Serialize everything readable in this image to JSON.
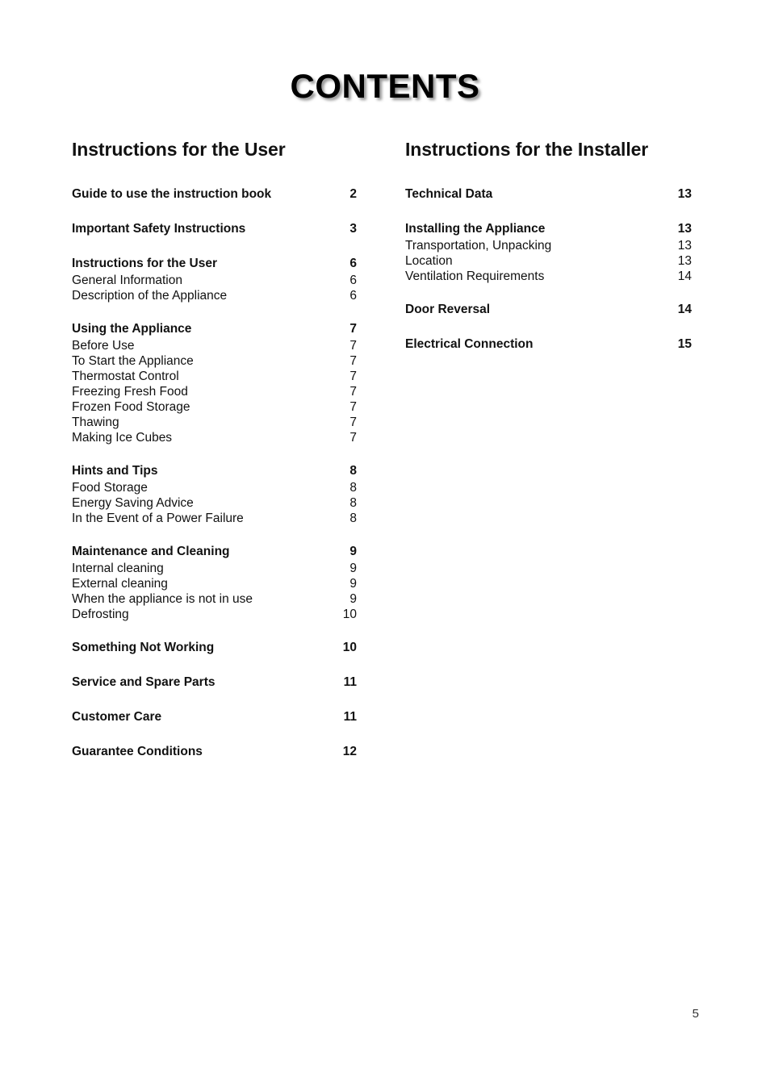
{
  "document": {
    "title": "CONTENTS",
    "folio": "5"
  },
  "columns": [
    {
      "heading": "Instructions for the User",
      "groups": [
        {
          "main": {
            "label": "Guide to use the instruction book",
            "page": "2"
          },
          "subs": []
        },
        {
          "main": {
            "label": "Important Safety Instructions",
            "page": "3"
          },
          "subs": []
        },
        {
          "main": {
            "label": "Instructions for the User",
            "page": "6"
          },
          "subs": [
            {
              "label": "General Information",
              "page": "6"
            },
            {
              "label": "Description of the Appliance",
              "page": "6"
            }
          ]
        },
        {
          "main": {
            "label": "Using the Appliance",
            "page": "7"
          },
          "subs": [
            {
              "label": "Before Use",
              "page": "7"
            },
            {
              "label": "To Start the Appliance",
              "page": "7"
            },
            {
              "label": "Thermostat Control",
              "page": "7"
            },
            {
              "label": "Freezing Fresh Food",
              "page": "7"
            },
            {
              "label": "Frozen Food Storage",
              "page": "7"
            },
            {
              "label": "Thawing",
              "page": "7"
            },
            {
              "label": "Making Ice Cubes",
              "page": "7"
            }
          ]
        },
        {
          "main": {
            "label": "Hints and Tips",
            "page": "8"
          },
          "subs": [
            {
              "label": "Food Storage",
              "page": "8"
            },
            {
              "label": "Energy Saving Advice",
              "page": "8"
            },
            {
              "label": "In the Event of a Power Failure",
              "page": "8"
            }
          ]
        },
        {
          "main": {
            "label": "Maintenance and Cleaning",
            "page": "9"
          },
          "subs": [
            {
              "label": "Internal cleaning",
              "page": "9"
            },
            {
              "label": "External cleaning",
              "page": "9"
            },
            {
              "label": "When the appliance is not in use",
              "page": "9"
            },
            {
              "label": "Defrosting",
              "page": "10"
            }
          ]
        },
        {
          "main": {
            "label": "Something Not Working",
            "page": "10"
          },
          "subs": []
        },
        {
          "main": {
            "label": "Service and Spare Parts",
            "page": "11"
          },
          "subs": []
        },
        {
          "main": {
            "label": "Customer Care",
            "page": "11"
          },
          "subs": []
        },
        {
          "main": {
            "label": "Guarantee Conditions",
            "page": "12"
          },
          "subs": []
        }
      ]
    },
    {
      "heading": "Instructions for the Installer",
      "groups": [
        {
          "main": {
            "label": "Technical Data",
            "page": "13"
          },
          "subs": []
        },
        {
          "main": {
            "label": "Installing the Appliance",
            "page": "13"
          },
          "subs": [
            {
              "label": "Transportation, Unpacking",
              "page": "13"
            },
            {
              "label": "Location",
              "page": "13"
            },
            {
              "label": "Ventilation Requirements",
              "page": "14"
            }
          ]
        },
        {
          "main": {
            "label": "Door Reversal",
            "page": "14"
          },
          "subs": []
        },
        {
          "main": {
            "label": "Electrical Connection",
            "page": "15"
          },
          "subs": []
        }
      ]
    }
  ]
}
